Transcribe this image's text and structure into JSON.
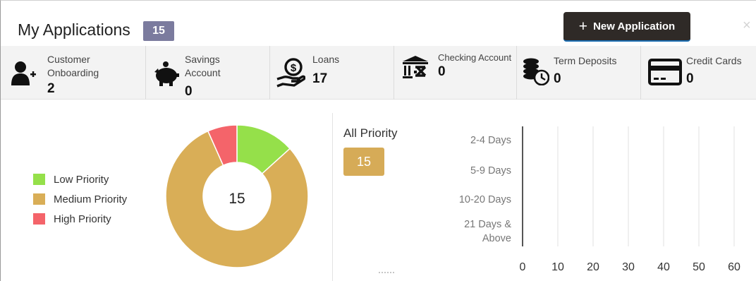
{
  "header": {
    "title": "My Applications",
    "count": "15",
    "new_button_label": "New Application",
    "new_button_icon": "plus-icon",
    "close_glyph": "×"
  },
  "categories": [
    {
      "label_line1": "Customer",
      "label_line2": "Onboarding",
      "value": "2",
      "icon": "add-user-icon"
    },
    {
      "label_line1": "Savings",
      "label_line2": "Account",
      "value": "0",
      "icon": "piggy-bank-icon"
    },
    {
      "label_line1": "Loans",
      "label_line2": "",
      "value": "17",
      "icon": "loan-hand-icon"
    },
    {
      "label_line1": "Checking Account",
      "label_line2": "",
      "value": "0",
      "icon": "bank-building-icon"
    },
    {
      "label_line1": "Term Deposits",
      "label_line2": "",
      "value": "0",
      "icon": "coins-clock-icon"
    },
    {
      "label_line1": "Credit Cards",
      "label_line2": "",
      "value": "0",
      "icon": "credit-card-icon"
    }
  ],
  "priority_summary": {
    "total": "15",
    "legend": [
      {
        "label": "Low Priority",
        "color": "#95e04a"
      },
      {
        "label": "Medium Priority",
        "color": "#d9ae57"
      },
      {
        "label": "High Priority",
        "color": "#f4646a"
      }
    ],
    "all_priority_label": "All Priority",
    "all_priority_count": "15"
  },
  "chart_data": [
    {
      "type": "pie",
      "categories": [
        "Low Priority",
        "Medium Priority",
        "High Priority"
      ],
      "values": [
        2,
        12,
        1
      ],
      "colors": [
        "#95e04a",
        "#d9ae57",
        "#f4646a"
      ],
      "center_label": "15",
      "donut": true
    },
    {
      "type": "bar",
      "orientation": "horizontal",
      "categories": [
        "2-4 Days",
        "5-9 Days",
        "10-20 Days",
        "21 Days & Above"
      ],
      "category_lines": [
        [
          "2-4 Days"
        ],
        [
          "5-9 Days"
        ],
        [
          "10-20 Days"
        ],
        [
          "21 Days &",
          "Above"
        ]
      ],
      "values": [
        0,
        0,
        0,
        0
      ],
      "xlim": [
        0,
        60
      ],
      "x_ticks": [
        "0",
        "10",
        "20",
        "30",
        "40",
        "50",
        "60"
      ],
      "grid": true
    }
  ]
}
